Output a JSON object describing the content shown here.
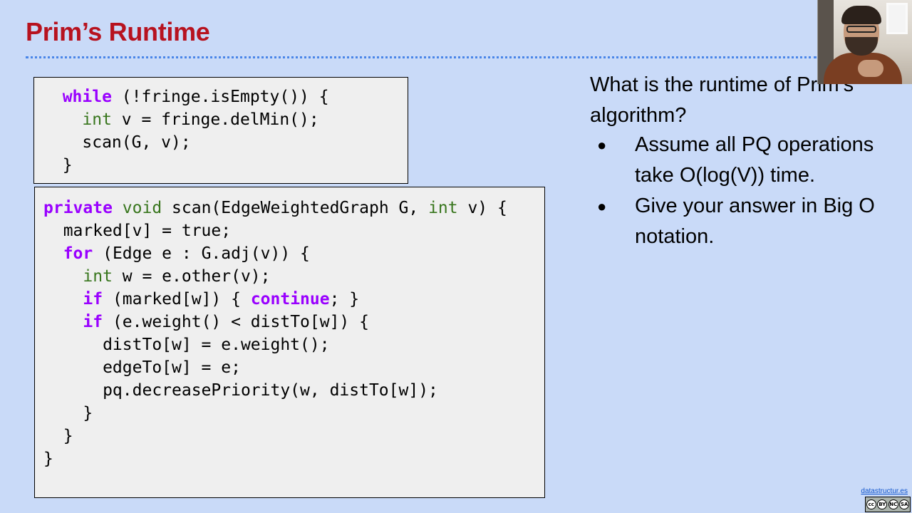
{
  "slide": {
    "title": "Prim’s Runtime"
  },
  "code_loop": {
    "lines": [
      [
        {
          "t": "  "
        },
        {
          "t": "while",
          "c": "kw"
        },
        {
          "t": " (!fringe.isEmpty()) {"
        }
      ],
      [
        {
          "t": "    "
        },
        {
          "t": "int",
          "c": "ty"
        },
        {
          "t": " v = fringe.delMin();"
        }
      ],
      [
        {
          "t": "    scan(G, v);"
        }
      ],
      [
        {
          "t": "  }"
        }
      ]
    ]
  },
  "code_scan": {
    "lines": [
      [
        {
          "t": "private",
          "c": "kw"
        },
        {
          "t": " "
        },
        {
          "t": "void",
          "c": "ty"
        },
        {
          "t": " scan(EdgeWeightedGraph G, "
        },
        {
          "t": "int",
          "c": "ty"
        },
        {
          "t": " v) {"
        }
      ],
      [
        {
          "t": "  marked[v] = true;"
        }
      ],
      [
        {
          "t": "  "
        },
        {
          "t": "for",
          "c": "kw"
        },
        {
          "t": " (Edge e : G.adj(v)) {"
        }
      ],
      [
        {
          "t": "    "
        },
        {
          "t": "int",
          "c": "ty"
        },
        {
          "t": " w = e.other(v);"
        }
      ],
      [
        {
          "t": "    "
        },
        {
          "t": "if",
          "c": "kw"
        },
        {
          "t": " (marked[w]) { "
        },
        {
          "t": "continue",
          "c": "kw"
        },
        {
          "t": "; }"
        }
      ],
      [
        {
          "t": "    "
        },
        {
          "t": "if",
          "c": "kw"
        },
        {
          "t": " (e.weight() < distTo[w]) {"
        }
      ],
      [
        {
          "t": "      distTo[w] = e.weight();"
        }
      ],
      [
        {
          "t": "      edgeTo[w] = e;"
        }
      ],
      [
        {
          "t": "      pq.decreasePriority(w, distTo[w]);"
        }
      ],
      [
        {
          "t": "    }"
        }
      ],
      [
        {
          "t": "  }"
        }
      ],
      [
        {
          "t": "}"
        }
      ]
    ]
  },
  "question": {
    "text": "What is the runtime of Prim’s algorithm?",
    "bullets": [
      "Assume all PQ operations take O(log(V)) time.",
      "Give your answer in Big O notation."
    ],
    "bullet_glyph": "●"
  },
  "footer": {
    "link_text": "datastructur.es",
    "license_badge": [
      "cc",
      "BY",
      "NC",
      "SA"
    ]
  },
  "colors": {
    "background": "#c9daf8",
    "title": "#b7121f",
    "keyword": "#9900ff",
    "type": "#38761d",
    "rule": "#4a86e8"
  }
}
